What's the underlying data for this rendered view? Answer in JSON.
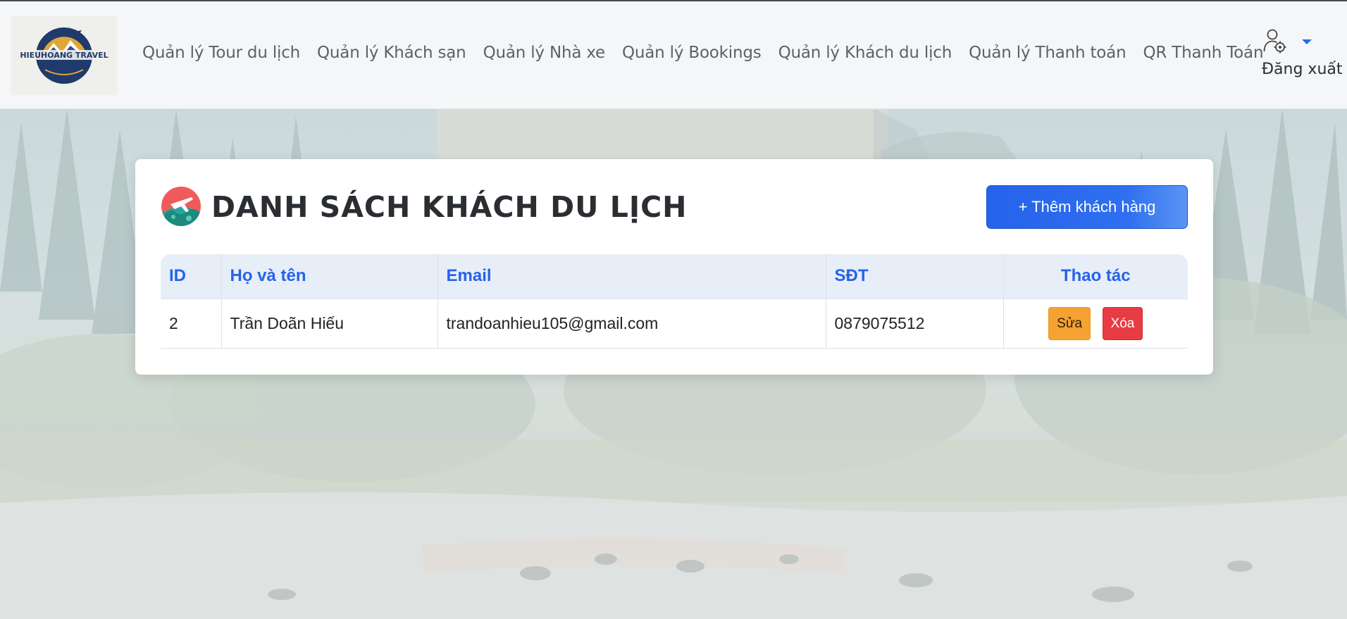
{
  "nav": {
    "logo_text": "HIEUHOANG TRAVEL",
    "links": [
      "Quản lý Tour du lịch",
      "Quản lý Khách sạn",
      "Quản lý Nhà xe",
      "Quản lý Bookings",
      "Quản lý Khách du lịch",
      "Quản lý Thanh toán",
      "QR Thanh Toán"
    ],
    "user_menu_icon": "user-gear-icon",
    "logout_label": "Đăng xuất"
  },
  "card": {
    "title_icon": "plane-globe-icon",
    "title": "DANH SÁCH KHÁCH DU LỊCH",
    "add_button": "+ Thêm khách hàng"
  },
  "table": {
    "headers": [
      "ID",
      "Họ và tên",
      "Email",
      "SĐT",
      "Thao tác"
    ],
    "rows": [
      {
        "id": "2",
        "name": "Trần Doãn Hiếu",
        "email": "trandoanhieu105@gmail.com",
        "phone": "0879075512",
        "edit_label": "Sửa",
        "delete_label": "Xóa"
      }
    ]
  },
  "colors": {
    "accent": "#2563eb",
    "edit": "#f5a233",
    "delete": "#e83c45"
  }
}
